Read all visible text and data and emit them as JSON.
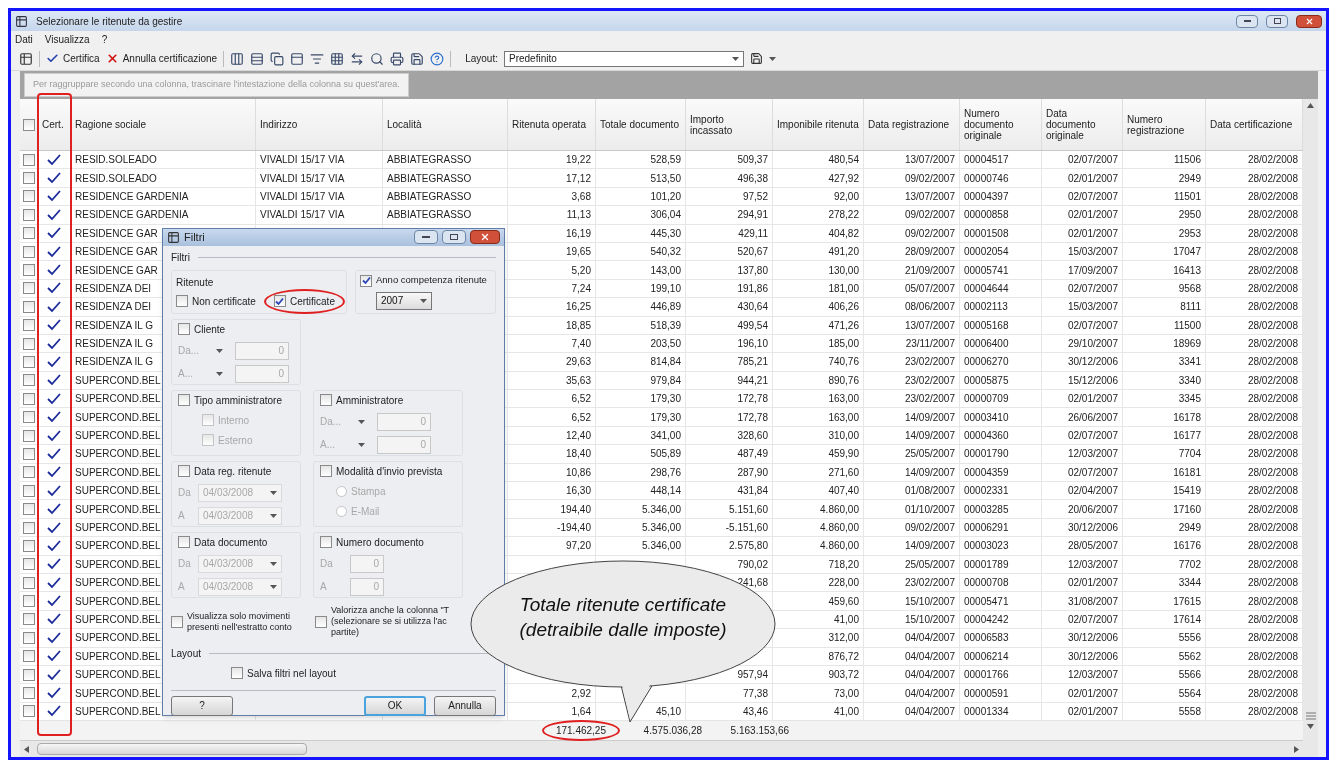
{
  "window": {
    "title": "Selezionare le ritenute da gestire"
  },
  "menu": [
    "Dati",
    "Visualizza",
    "?"
  ],
  "toolbar": {
    "certify": "Certifica",
    "uncertify": "Annulla certificazione",
    "layout_label": "Layout:",
    "layout_value": "Predefinito"
  },
  "group_hint": "Per raggruppare secondo una colonna, trascinare l'intestazione della colonna su quest'area.",
  "header_checkbox": {
    "checked": false
  },
  "columns": [
    "Cert.",
    "Ragione sociale",
    "Indirizzo",
    "Località",
    "Ritenuta operata",
    "Totale documento",
    "Importo incassato",
    "Imponibile ritenuta",
    "Data registrazione",
    "Numero documento originale",
    "Data documento originale",
    "Numero registrazione",
    "Data certificazione"
  ],
  "annotations": {
    "cert_column_frame": true,
    "certificate_option_ellipse": true,
    "first_total_ellipse": true
  },
  "rows": [
    {
      "checked": false,
      "certified": true,
      "cells": [
        "RESID.SOLEADO",
        "VIVALDI 15/17 VIA",
        "ABBIATEGRASSO",
        "19,22",
        "528,59",
        "509,37",
        "480,54",
        "13/07/2007",
        "00004517",
        "02/07/2007",
        "11506",
        "28/02/2008"
      ]
    },
    {
      "checked": false,
      "certified": true,
      "cells": [
        "RESID.SOLEADO",
        "VIVALDI 15/17 VIA",
        "ABBIATEGRASSO",
        "17,12",
        "513,50",
        "496,38",
        "427,92",
        "09/02/2007",
        "00000746",
        "02/01/2007",
        "2949",
        "28/02/2008"
      ]
    },
    {
      "checked": false,
      "certified": true,
      "cells": [
        "RESIDENCE GARDENIA",
        "VIVALDI 15/17 VIA",
        "ABBIATEGRASSO",
        "3,68",
        "101,20",
        "97,52",
        "92,00",
        "13/07/2007",
        "00004397",
        "02/07/2007",
        "11501",
        "28/02/2008"
      ]
    },
    {
      "checked": false,
      "certified": true,
      "cells": [
        "RESIDENCE GARDENIA",
        "VIVALDI 15/17 VIA",
        "ABBIATEGRASSO",
        "11,13",
        "306,04",
        "294,91",
        "278,22",
        "09/02/2007",
        "00000858",
        "02/01/2007",
        "2950",
        "28/02/2008"
      ]
    },
    {
      "checked": false,
      "certified": true,
      "cells": [
        "RESIDENCE GAR",
        null,
        null,
        "16,19",
        "445,30",
        "429,11",
        "404,82",
        "09/02/2007",
        "00001508",
        "02/01/2007",
        "2953",
        "28/02/2008"
      ]
    },
    {
      "checked": false,
      "certified": true,
      "cells": [
        "RESIDENCE GAR",
        null,
        null,
        "19,65",
        "540,32",
        "520,67",
        "491,20",
        "28/09/2007",
        "00002054",
        "15/03/2007",
        "17047",
        "28/02/2008"
      ]
    },
    {
      "checked": false,
      "certified": true,
      "cells": [
        "RESIDENCE GAR",
        null,
        null,
        "5,20",
        "143,00",
        "137,80",
        "130,00",
        "21/09/2007",
        "00005741",
        "17/09/2007",
        "16413",
        "28/02/2008"
      ]
    },
    {
      "checked": false,
      "certified": true,
      "cells": [
        "RESIDENZA DEI",
        null,
        null,
        "7,24",
        "199,10",
        "191,86",
        "181,00",
        "05/07/2007",
        "00004644",
        "02/07/2007",
        "9568",
        "28/02/2008"
      ]
    },
    {
      "checked": false,
      "certified": true,
      "cells": [
        "RESIDENZA DEI",
        null,
        null,
        "16,25",
        "446,89",
        "430,64",
        "406,26",
        "08/06/2007",
        "00002113",
        "15/03/2007",
        "8111",
        "28/02/2008"
      ]
    },
    {
      "checked": false,
      "certified": true,
      "cells": [
        "RESIDENZA IL G",
        null,
        null,
        "18,85",
        "518,39",
        "499,54",
        "471,26",
        "13/07/2007",
        "00005168",
        "02/07/2007",
        "11500",
        "28/02/2008"
      ]
    },
    {
      "checked": false,
      "certified": true,
      "cells": [
        "RESIDENZA IL G",
        null,
        null,
        "7,40",
        "203,50",
        "196,10",
        "185,00",
        "23/11/2007",
        "00006400",
        "29/10/2007",
        "18969",
        "28/02/2008"
      ]
    },
    {
      "checked": false,
      "certified": true,
      "cells": [
        "RESIDENZA IL G",
        null,
        null,
        "29,63",
        "814,84",
        "785,21",
        "740,76",
        "23/02/2007",
        "00006270",
        "30/12/2006",
        "3341",
        "28/02/2008"
      ]
    },
    {
      "checked": false,
      "certified": true,
      "cells": [
        "SUPERCOND.BEL",
        null,
        null,
        "35,63",
        "979,84",
        "944,21",
        "890,76",
        "23/02/2007",
        "00005875",
        "15/12/2006",
        "3340",
        "28/02/2008"
      ]
    },
    {
      "checked": false,
      "certified": true,
      "cells": [
        "SUPERCOND.BEL",
        null,
        null,
        "6,52",
        "179,30",
        "172,78",
        "163,00",
        "23/02/2007",
        "00000709",
        "02/01/2007",
        "3345",
        "28/02/2008"
      ]
    },
    {
      "checked": false,
      "certified": true,
      "cells": [
        "SUPERCOND.BEL",
        null,
        null,
        "6,52",
        "179,30",
        "172,78",
        "163,00",
        "14/09/2007",
        "00003410",
        "26/06/2007",
        "16178",
        "28/02/2008"
      ]
    },
    {
      "checked": false,
      "certified": true,
      "cells": [
        "SUPERCOND.BEL",
        null,
        null,
        "12,40",
        "341,00",
        "328,60",
        "310,00",
        "14/09/2007",
        "00004360",
        "02/07/2007",
        "16177",
        "28/02/2008"
      ]
    },
    {
      "checked": false,
      "certified": true,
      "cells": [
        "SUPERCOND.BEL",
        null,
        null,
        "18,40",
        "505,89",
        "487,49",
        "459,90",
        "25/05/2007",
        "00001790",
        "12/03/2007",
        "7704",
        "28/02/2008"
      ]
    },
    {
      "checked": false,
      "certified": true,
      "cells": [
        "SUPERCOND.BEL",
        null,
        null,
        "10,86",
        "298,76",
        "287,90",
        "271,60",
        "14/09/2007",
        "00004359",
        "02/07/2007",
        "16181",
        "28/02/2008"
      ]
    },
    {
      "checked": false,
      "certified": true,
      "cells": [
        "SUPERCOND.BEL",
        null,
        null,
        "16,30",
        "448,14",
        "431,84",
        "407,40",
        "01/08/2007",
        "00002331",
        "02/04/2007",
        "15419",
        "28/02/2008"
      ]
    },
    {
      "checked": false,
      "certified": true,
      "cells": [
        "SUPERCOND.BEL",
        null,
        null,
        "194,40",
        "5.346,00",
        "5.151,60",
        "4.860,00",
        "01/10/2007",
        "00003285",
        "20/06/2007",
        "17160",
        "28/02/2008"
      ]
    },
    {
      "checked": false,
      "certified": true,
      "cells": [
        "SUPERCOND.BEL",
        null,
        null,
        "-194,40",
        "5.346,00",
        "-5.151,60",
        "4.860,00",
        "09/02/2007",
        "00006291",
        "30/12/2006",
        "2949",
        "28/02/2008"
      ]
    },
    {
      "checked": false,
      "certified": true,
      "cells": [
        "SUPERCOND.BEL",
        null,
        null,
        "97,20",
        "5.346,00",
        "2.575,80",
        "4.860,00",
        "14/09/2007",
        "00003023",
        "28/05/2007",
        "16176",
        "28/02/2008"
      ]
    },
    {
      "checked": false,
      "certified": true,
      "cells": [
        "SUPERCOND.BEL",
        null,
        null,
        null,
        null,
        "790,02",
        "718,20",
        "25/05/2007",
        "00001789",
        "12/03/2007",
        "7702",
        "28/02/2008"
      ]
    },
    {
      "checked": false,
      "certified": true,
      "cells": [
        "SUPERCOND.BEL",
        null,
        null,
        null,
        null,
        "241,68",
        "228,00",
        "23/02/2007",
        "00000708",
        "02/01/2007",
        "3344",
        "28/02/2008"
      ]
    },
    {
      "checked": false,
      "certified": true,
      "cells": [
        "SUPERCOND.BEL",
        null,
        null,
        null,
        null,
        null,
        "459,60",
        "15/10/2007",
        "00005471",
        "31/08/2007",
        "17615",
        "28/02/2008"
      ]
    },
    {
      "checked": false,
      "certified": true,
      "cells": [
        "SUPERCOND.BEL",
        null,
        null,
        null,
        null,
        null,
        "41,00",
        "15/10/2007",
        "00004242",
        "02/07/2007",
        "17614",
        "28/02/2008"
      ]
    },
    {
      "checked": false,
      "certified": true,
      "cells": [
        "SUPERCOND.BEL",
        null,
        null,
        null,
        null,
        null,
        "312,00",
        "04/04/2007",
        "00006583",
        "30/12/2006",
        "5556",
        "28/02/2008"
      ]
    },
    {
      "checked": false,
      "certified": true,
      "cells": [
        "SUPERCOND.BEL",
        null,
        null,
        null,
        null,
        null,
        "876,72",
        "04/04/2007",
        "00006214",
        "30/12/2006",
        "5562",
        "28/02/2008"
      ]
    },
    {
      "checked": false,
      "certified": true,
      "cells": [
        "SUPERCOND.BEL",
        null,
        null,
        null,
        null,
        "957,94",
        "903,72",
        "04/04/2007",
        "00001766",
        "12/03/2007",
        "5566",
        "28/02/2008"
      ]
    },
    {
      "checked": false,
      "certified": true,
      "cells": [
        "SUPERCOND.BEL",
        null,
        null,
        "2,92",
        null,
        "77,38",
        "73,00",
        "04/04/2007",
        "00000591",
        "02/01/2007",
        "5564",
        "28/02/2008"
      ]
    },
    {
      "checked": false,
      "certified": true,
      "cells": [
        "SUPERCOND.BEL",
        null,
        null,
        "1,64",
        "45,10",
        "43,46",
        "41,00",
        "04/04/2007",
        "00001334",
        "02/01/2007",
        "5558",
        "28/02/2008"
      ]
    }
  ],
  "totals": [
    "171.462,25",
    "4.575.036,28",
    "5.163.153,66"
  ],
  "dialog": {
    "title": "Filtri",
    "section": "Filtri",
    "ritenute": {
      "label": "Ritenute",
      "options": [
        {
          "label": "Non certificate",
          "checked": false
        },
        {
          "label": "Certificate",
          "checked": true
        }
      ]
    },
    "anno": {
      "label": "Anno competenza ritenute",
      "checked": true,
      "value": "2007"
    },
    "groups": [
      {
        "kind": "combo",
        "label": "Cliente",
        "checked": false,
        "rows": [
          {
            "label": "Da...",
            "value": "0"
          },
          {
            "label": "A...",
            "value": "0"
          }
        ]
      },
      {
        "kind": "checks",
        "label": "Tipo amministratore",
        "checked": false,
        "options": [
          {
            "label": "Interno",
            "checked": false
          },
          {
            "label": "Esterno",
            "checked": false
          }
        ]
      },
      {
        "kind": "combo",
        "label": "Amministratore",
        "checked": false,
        "rows": [
          {
            "label": "Da...",
            "value": "0"
          },
          {
            "label": "A...",
            "value": "0"
          }
        ]
      },
      {
        "kind": "date",
        "label": "Data reg. ritenute",
        "checked": false,
        "rows": [
          {
            "label": "Da",
            "value": "04/03/2008"
          },
          {
            "label": "A",
            "value": "04/03/2008"
          }
        ]
      },
      {
        "kind": "radio",
        "label": "Modalità d'invio prevista",
        "checked": false,
        "options": [
          {
            "label": "Stampa",
            "selected": false
          },
          {
            "label": "E-Mail",
            "selected": false
          }
        ]
      },
      {
        "kind": "date",
        "label": "Data documento",
        "checked": false,
        "rows": [
          {
            "label": "Da",
            "value": "04/03/2008"
          },
          {
            "label": "A",
            "value": "04/03/2008"
          }
        ]
      },
      {
        "kind": "number",
        "label": "Numero documento",
        "checked": false,
        "rows": [
          {
            "label": "Da",
            "value": "0"
          },
          {
            "label": "A",
            "value": "0"
          }
        ]
      }
    ],
    "options": [
      {
        "lines": [
          "Visualizza solo movimenti",
          "presenti nell'estratto conto"
        ],
        "checked": false
      },
      {
        "lines": [
          "Valorizza anche la colonna \"T",
          "(selezionare se si utilizza l'ac",
          "partite)"
        ],
        "checked": false
      }
    ],
    "layout": {
      "label": "Layout",
      "option": {
        "label": "Salva filtri nel layout",
        "checked": false
      }
    },
    "buttons": [
      {
        "label": "?",
        "default": false
      },
      {
        "label": "OK",
        "default": true
      },
      {
        "label": "Annulla",
        "default": false
      }
    ]
  },
  "callout": {
    "lines": [
      "Totale ritenute certificate",
      "(detraibile dalle imposte)"
    ]
  }
}
